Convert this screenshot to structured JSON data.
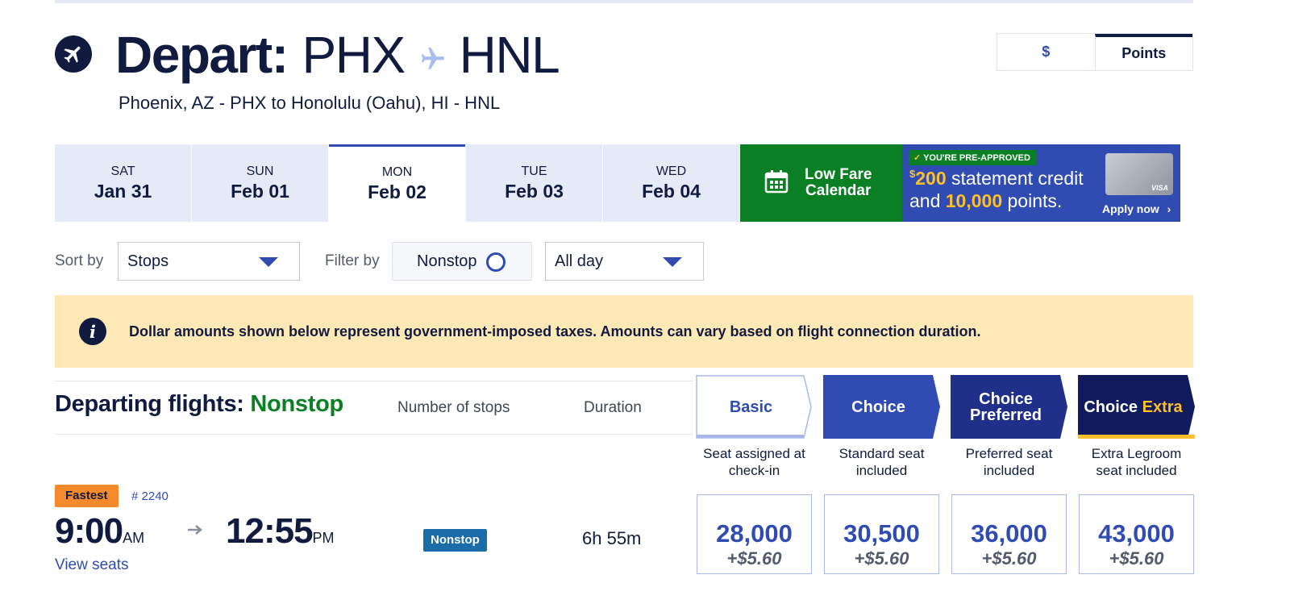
{
  "header": {
    "depart_label": "Depart:",
    "origin": "PHX",
    "destination": "HNL",
    "route_text": "Phoenix, AZ - PHX to Honolulu (Oahu), HI - HNL"
  },
  "currency_toggle": {
    "dollar_label": "$",
    "points_label": "Points",
    "selected": "Points"
  },
  "date_tabs": [
    {
      "dow": "SAT",
      "date": "Jan 31"
    },
    {
      "dow": "SUN",
      "date": "Feb 01"
    },
    {
      "dow": "MON",
      "date": "Feb 02",
      "selected": true
    },
    {
      "dow": "TUE",
      "date": "Feb 03"
    },
    {
      "dow": "WED",
      "date": "Feb 04"
    }
  ],
  "low_fare": {
    "line1": "Low Fare",
    "line2": "Calendar",
    "icon": "calendar-icon"
  },
  "promo": {
    "badge": "YOU'RE PRE-APPROVED",
    "currency_symbol": "$",
    "amount": "200",
    "line1_rest": " statement credit",
    "line2_prefix": "and ",
    "points_amount": "10,000",
    "line2_suffix": " points.",
    "cta": "Apply now",
    "card_brand": "VISA"
  },
  "controls": {
    "sort_label": "Sort by",
    "sort_value": "Stops",
    "filter_label": "Filter by",
    "nonstop_label": "Nonstop",
    "time_value": "All day"
  },
  "notice": {
    "icon_glyph": "i",
    "text": "Dollar amounts shown below represent government-imposed taxes. Amounts can vary based on flight connection duration."
  },
  "results_header": {
    "title_prefix": "Departing flights: ",
    "title_highlight": "Nonstop",
    "col_stops": "Number of stops",
    "col_duration": "Duration"
  },
  "fare_classes": [
    {
      "name": "Basic",
      "desc_line1": "Seat assigned at",
      "desc_line2": "check-in"
    },
    {
      "name": "Choice",
      "desc_line1": "Standard seat",
      "desc_line2": "included"
    },
    {
      "name_line1": "Choice",
      "name_line2": "Preferred",
      "desc_line1": "Preferred seat",
      "desc_line2": "included"
    },
    {
      "name_main": "Choice",
      "name_accent": "Extra",
      "desc_line1": "Extra Legroom",
      "desc_line2": "seat included"
    }
  ],
  "flight": {
    "badge": "Fastest",
    "number": "# 2240",
    "depart_time": "9:00",
    "depart_ampm": "AM",
    "arrive_time": "12:55",
    "arrive_ampm": "PM",
    "view_seats": "View seats",
    "stops": "Nonstop",
    "duration": "6h 55m",
    "prices": [
      {
        "points": "28,000",
        "tax": "+$5.60"
      },
      {
        "points": "30,500",
        "tax": "+$5.60"
      },
      {
        "points": "36,000",
        "tax": "+$5.60"
      },
      {
        "points": "43,000",
        "tax": "+$5.60"
      }
    ]
  },
  "colors": {
    "navy": "#111b40",
    "blue": "#304cb2",
    "green": "#0b7f24",
    "gold": "#ffbf27",
    "notice_bg": "#fde8b6",
    "fastest_orange": "#f48a2c"
  }
}
